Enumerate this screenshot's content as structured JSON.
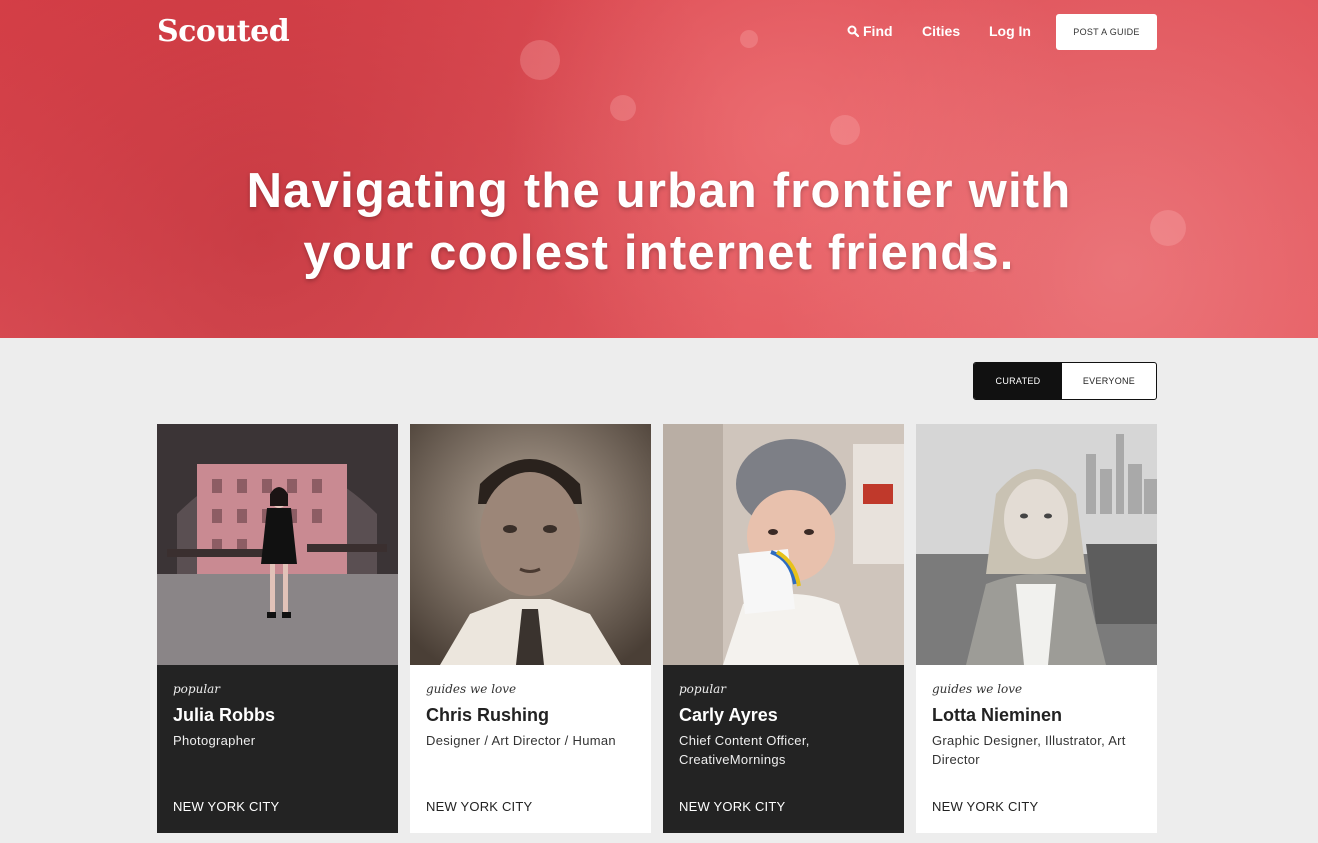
{
  "brand": {
    "logo": "Scouted"
  },
  "nav": {
    "find": "Find",
    "cities": "Cities",
    "login": "Log In",
    "post_guide": "POST A GUIDE"
  },
  "hero": {
    "line1": "Navigating the urban frontier with",
    "line2": "your coolest internet friends."
  },
  "filter": {
    "options": [
      "CURATED",
      "EVERYONE"
    ],
    "selected": "CURATED"
  },
  "guides": [
    {
      "tag": "popular",
      "name": "Julia Robbs",
      "role": "Photographer",
      "city": "NEW YORK CITY",
      "style": "dark"
    },
    {
      "tag": "guides we love",
      "name": "Chris Rushing",
      "role": "Designer / Art Director / Human",
      "city": "NEW YORK CITY",
      "style": "light"
    },
    {
      "tag": "popular",
      "name": "Carly Ayres",
      "role": "Chief Content Officer, CreativeMornings",
      "city": "NEW YORK CITY",
      "style": "dark"
    },
    {
      "tag": "guides we love",
      "name": "Lotta Nieminen",
      "role": "Graphic Designer, Illustrator, Art Director",
      "city": "NEW YORK CITY",
      "style": "light"
    }
  ],
  "colors": {
    "hero_red": "#e0545b",
    "card_dark": "#232323",
    "page_bg": "#ededed"
  }
}
